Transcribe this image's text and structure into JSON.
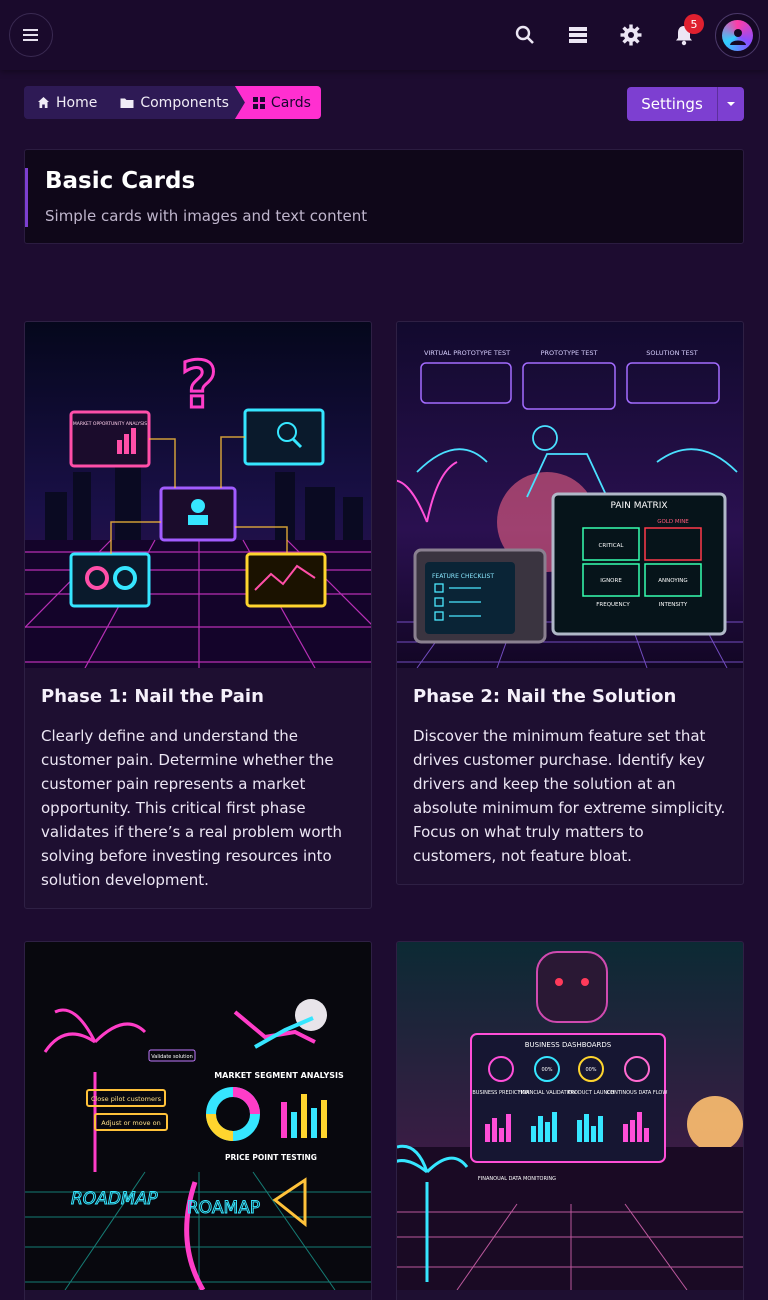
{
  "topbar": {
    "icons": [
      "menu-icon",
      "search-icon",
      "storage-icon",
      "gear-icon",
      "bell-icon",
      "avatar-icon"
    ],
    "notification_count": "5",
    "accent": "#7d3fd1"
  },
  "breadcrumb": {
    "items": [
      {
        "label": "Home",
        "icon": "home-icon"
      },
      {
        "label": "Components",
        "icon": "folder-icon"
      },
      {
        "label": "Cards",
        "icon": "grid-icon"
      }
    ],
    "active_color": "#ff2fd0"
  },
  "settings": {
    "label": "Settings"
  },
  "header": {
    "title": "Basic Cards",
    "subtitle": "Simple cards with images and text content"
  },
  "cards": [
    {
      "title": "Phase 1: Nail the Pain",
      "text": "Clearly define and understand the customer pain. Determine whether the customer pain represents a market opportunity. This critical first phase validates if there’s a real problem worth solving before investing resources into solution development.",
      "image_labels": [
        "MARKET OPPORTUNITY ANALYSIS"
      ]
    },
    {
      "title": "Phase 2: Nail the Solution",
      "text": "Discover the minimum feature set that drives customer purchase. Identify key drivers and keep the solution at an absolute minimum for extreme simplicity. Focus on what truly matters to customers, not feature bloat.",
      "image_labels": [
        "VIRTUAL PROTOTYPE TEST",
        "PROTOTYPE TEST",
        "SOLUTION TEST",
        "PAIN MATRIX",
        "GOLD MINE",
        "CRITICAL",
        "IGNORE",
        "ANNOYING",
        "FREQUENCY",
        "INTENSITY",
        "FEATURE CHECKLIST"
      ]
    },
    {
      "title": "",
      "text": "",
      "image_labels": [
        "Validate solution",
        "Close pilot customers",
        "Adjust or move on",
        "MARKET SEGMENT ANALYSIS",
        "PRICE POINT TESTING",
        "ROADMAP",
        "ROAMAP"
      ]
    },
    {
      "title": "",
      "text": "",
      "image_labels": [
        "BUSINESS DASHBOARDS",
        "00%",
        "00%",
        "BUSINESS PREDICTION",
        "FINANCIAL VALIDATION",
        "PRODUCT LAUNCH",
        "CONTINOUS DATA FLOW",
        "FINANOUAL DATA MONITORING"
      ]
    }
  ]
}
